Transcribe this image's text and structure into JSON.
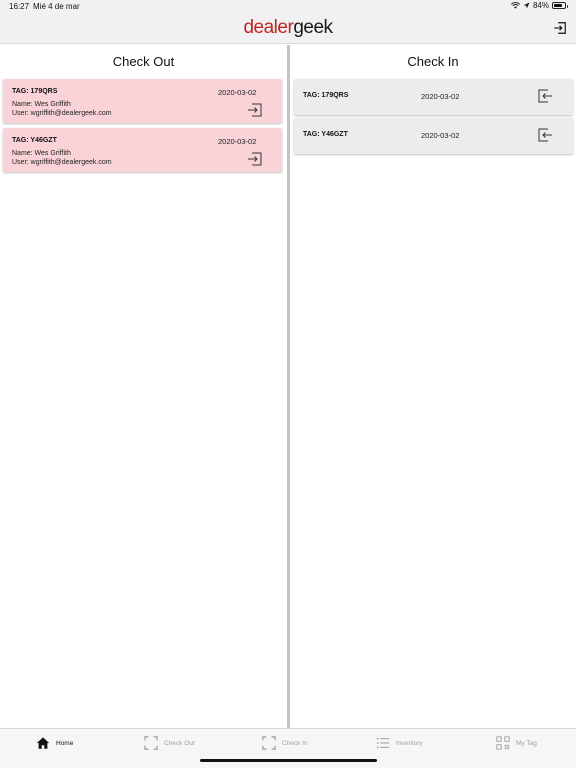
{
  "status_bar": {
    "time": "16:27",
    "date": "Mié 4 de mar",
    "battery_percent": "84%",
    "battery_level": 0.84
  },
  "app": {
    "logo_part1": "dealer",
    "logo_part2": "geek",
    "brand_color": "#c0261d"
  },
  "check_out": {
    "title": "Check Out",
    "items": [
      {
        "tag": "TAG: 179QRS",
        "date": "2020-03-02",
        "name": "Name: Wes Griffith",
        "user": "User: wgriffith@dealergeek.com",
        "icon": "check-in-icon"
      },
      {
        "tag": "TAG: Y46GZT",
        "date": "2020-03-02",
        "name": "Name: Wes Griffith",
        "user": "User: wgriffith@dealergeek.com",
        "icon": "check-in-icon"
      }
    ],
    "card_color": "#f9d3d8"
  },
  "check_in": {
    "title": "Check In",
    "items": [
      {
        "tag": "TAG: 179QRS",
        "date": "2020-03-02",
        "icon": "check-out-icon"
      },
      {
        "tag": "TAG: Y46GZT",
        "date": "2020-03-02",
        "icon": "check-out-icon"
      }
    ],
    "card_color": "#ececef"
  },
  "tabs": [
    {
      "label": "Home",
      "icon": "home-icon",
      "active": true
    },
    {
      "label": "Check Out",
      "icon": "scan-icon",
      "active": false
    },
    {
      "label": "Check In",
      "icon": "scan-icon",
      "active": false
    },
    {
      "label": "Inventory",
      "icon": "list-icon",
      "active": false
    },
    {
      "label": "My Tag",
      "icon": "qr-code-icon",
      "active": false
    }
  ]
}
